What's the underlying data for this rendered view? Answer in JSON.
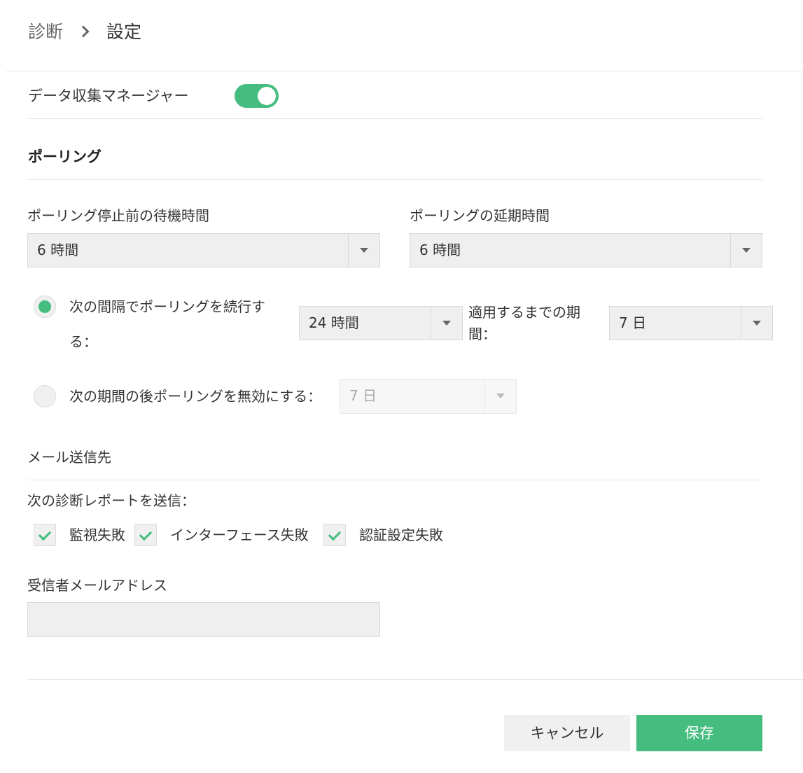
{
  "breadcrumb": {
    "parent": "診断",
    "current": "設定"
  },
  "data_collection": {
    "label": "データ収集マネージャー",
    "enabled": true
  },
  "polling": {
    "title": "ポーリング",
    "wait_label": "ポーリング停止前の待機時間",
    "wait_value": "6 時間",
    "extend_label": "ポーリングの延期時間",
    "extend_value": "6 時間",
    "continue_text_line1": "次の間隔でポーリングを続行す",
    "continue_text_line2": "る：",
    "continue_interval": "24 時間",
    "apply_label_line1": "適用するまでの期",
    "apply_label_line2": "間：",
    "apply_value": "7 日",
    "disable_text": "次の期間の後ポーリングを無効にする：",
    "disable_value": "7 日",
    "selected_option": "continue"
  },
  "mail": {
    "section_label": "メール送信先",
    "reports_label": "次の診断レポートを送信：",
    "checkboxes": [
      {
        "label": "監視失敗",
        "checked": true
      },
      {
        "label": "インターフェース失敗",
        "checked": true
      },
      {
        "label": "認証設定失敗",
        "checked": true
      }
    ],
    "recipient_label": "受信者メールアドレス",
    "recipient_value": ""
  },
  "buttons": {
    "cancel": "キャンセル",
    "save": "保存"
  },
  "colors": {
    "accent": "#45bd7e"
  }
}
